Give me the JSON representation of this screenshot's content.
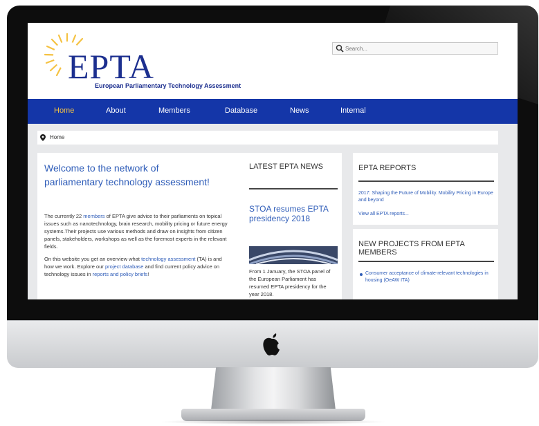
{
  "header": {
    "logo_text": "EPTA",
    "logo_subtitle": "European Parliamentary Technology Assessment"
  },
  "search": {
    "placeholder": "Search..."
  },
  "nav": {
    "items": [
      {
        "label": "Home",
        "active": true
      },
      {
        "label": "About"
      },
      {
        "label": "Members"
      },
      {
        "label": "Database"
      },
      {
        "label": "News"
      },
      {
        "label": "Internal"
      }
    ]
  },
  "breadcrumb": {
    "label": "Home"
  },
  "main": {
    "heading": "Welcome to the network of parliamentary technology assessment!",
    "intro": {
      "p1_a": "The currently 22 ",
      "p1_link": "members",
      "p1_b": " of EPTA give advice to their parliaments on topical issues such as nanotechnology, brain research, mobility pricing or future energy systems.Their projects use various methods and draw on insights from citizen panels, stakeholders, workshops as well as the foremost experts in the relevant fields.",
      "p2_a": "On this website you get an overview what ",
      "p2_link1": "technology assessment",
      "p2_b": " (TA) is and how we work. Explore our ",
      "p2_link2": "project database",
      "p2_c": " and find current policy advice on technology issues in ",
      "p2_link3": "reports and policy briefs",
      "p2_d": "!"
    }
  },
  "news": {
    "heading": "LATEST EPTA NEWS",
    "article_title": "STOA resumes EPTA presidency 2018",
    "article_body": "From 1 January, the STOA panel of the European Parliament has resumed EPTA presidency for the year 2018."
  },
  "reports": {
    "heading": "EPTA REPORTS",
    "link1": "2017: Shaping the Future of Mobility. Mobility Pricing in Europe and beyond",
    "link2": "View all EPTA reports..."
  },
  "projects": {
    "heading": "NEW PROJECTS FROM EPTA MEMBERS",
    "item1": "Consumer acceptance of climate-relevant technologies in housing (OeAW ITA)"
  },
  "colors": {
    "nav_bg": "#1436a8",
    "brand_blue": "#1c2f8f",
    "link_blue": "#2e5cb8",
    "active_nav": "#f5c242",
    "logo_yellow": "#f5c242"
  },
  "icons": [
    "sunburst-logo-icon",
    "search-icon",
    "map-pin-icon",
    "apple-logo-icon"
  ]
}
